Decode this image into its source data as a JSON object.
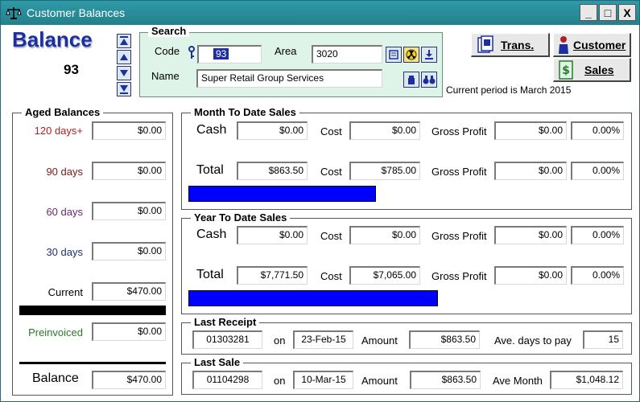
{
  "window": {
    "title": "Customer Balances",
    "controls": [
      "_",
      "□",
      "X"
    ]
  },
  "header": {
    "heading": "Balance",
    "customer_number": "93",
    "period_text": "Current period is March 2015"
  },
  "search": {
    "title": "Search",
    "code_label": "Code",
    "code_value": "93",
    "area_label": "Area",
    "area_value": "3020",
    "name_label": "Name",
    "name_value": "Super Retail Group Services"
  },
  "buttons": {
    "trans": "Trans.",
    "customer": "Customer",
    "sales": "Sales"
  },
  "aged": {
    "title": "Aged Balances",
    "rows": [
      {
        "label": "120 days+",
        "value": "$0.00",
        "color": "#b02020"
      },
      {
        "label": "90 days",
        "value": "$0.00",
        "color": "#7a1818"
      },
      {
        "label": "60 days",
        "value": "$0.00",
        "color": "#6a2a6a"
      },
      {
        "label": "30 days",
        "value": "$0.00",
        "color": "#1f2f6f"
      },
      {
        "label": "Current",
        "value": "$470.00",
        "color": "#000000"
      }
    ],
    "preinvoiced_label": "Preinvoiced",
    "preinvoiced_value": "$0.00",
    "preinvoiced_color": "#2a7a2a",
    "balance_label": "Balance",
    "balance_value": "$470.00"
  },
  "mtd": {
    "title": "Month To Date Sales",
    "cash_label": "Cash",
    "cash_value": "$0.00",
    "cash_cost": "$0.00",
    "cash_gp": "$0.00",
    "cash_pct": "0.00%",
    "total_label": "Total",
    "total_value": "$863.50",
    "total_cost": "$785.00",
    "total_gp": "$0.00",
    "total_pct": "0.00%",
    "cost_label": "Cost",
    "gp_label": "Gross Profit",
    "bar_color": "#0000ff"
  },
  "ytd": {
    "title": "Year To Date Sales",
    "cash_label": "Cash",
    "cash_value": "$0.00",
    "cash_cost": "$0.00",
    "cash_gp": "$0.00",
    "cash_pct": "0.00%",
    "total_label": "Total",
    "total_value": "$7,771.50",
    "total_cost": "$7,065.00",
    "total_gp": "$0.00",
    "total_pct": "0.00%",
    "cost_label": "Cost",
    "gp_label": "Gross Profit",
    "bar_color": "#0000ff"
  },
  "last_receipt": {
    "title": "Last Receipt",
    "number": "01303281",
    "on_label": "on",
    "date": "23-Feb-15",
    "amount_label": "Amount",
    "amount": "$863.50",
    "days_label": "Ave. days to pay",
    "days": "15"
  },
  "last_sale": {
    "title": "Last Sale",
    "number": "01104298",
    "on_label": "on",
    "date": "10-Mar-15",
    "amount_label": "Amount",
    "amount": "$863.50",
    "ave_month_label": "Ave Month",
    "ave_month": "$1,048.12"
  }
}
